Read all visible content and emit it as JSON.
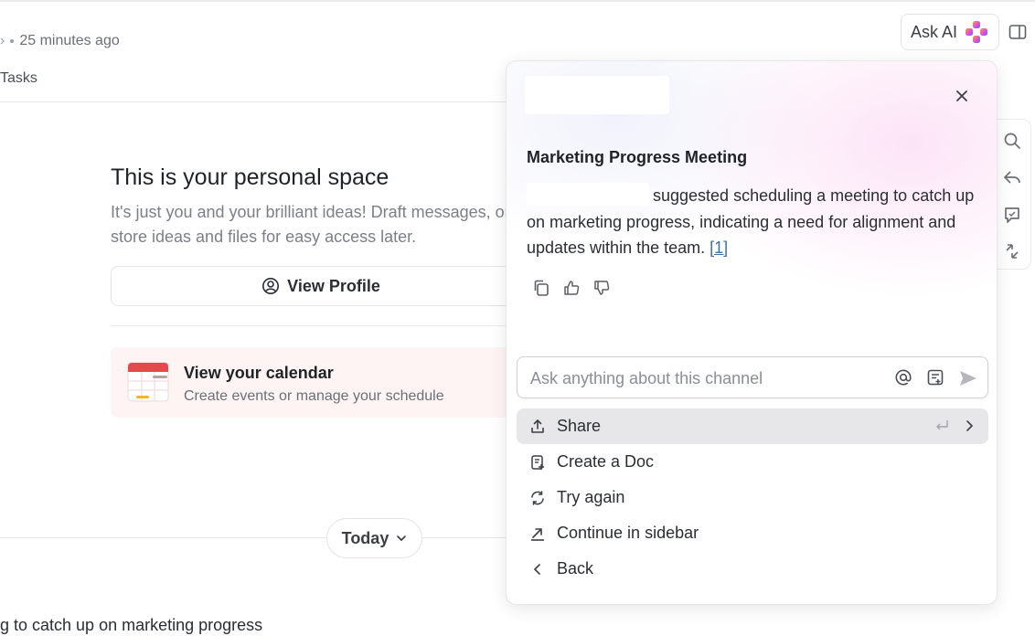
{
  "header": {
    "time_ago": "25 minutes ago",
    "tab_label": "Tasks",
    "ask_ai_label": "Ask AI"
  },
  "personal_space": {
    "title": "This is your personal space",
    "description": "It's just you and your brilliant ideas! Draft messages, or store ideas and files for easy access later.",
    "view_profile_label": "View Profile",
    "calendar": {
      "title": "View your calendar",
      "subtitle": "Create events or manage your schedule"
    }
  },
  "feed": {
    "today_label": "Today",
    "message_fragment": "g to catch up on marketing progress"
  },
  "ai_panel": {
    "answer_title": "Marketing Progress Meeting",
    "answer_body": "suggested scheduling a meeting to catch up on marketing progress, indicating a need for alignment and updates within the team.",
    "citation": "[1]",
    "input_placeholder": "Ask anything about this channel",
    "menu": [
      {
        "label": "Share",
        "icon": "share-icon"
      },
      {
        "label": "Create a Doc",
        "icon": "doc-icon"
      },
      {
        "label": "Try again",
        "icon": "refresh-icon"
      },
      {
        "label": "Continue in sidebar",
        "icon": "arrow-up-right-icon"
      },
      {
        "label": "Back",
        "icon": "chevron-left-icon"
      }
    ]
  },
  "colors": {
    "accent_ai_gradient": [
      "#f5a623",
      "#e94fd6",
      "#6b5cff"
    ],
    "calendar_card_bg": "#fff4f4",
    "citation": "#3b6fb6"
  }
}
